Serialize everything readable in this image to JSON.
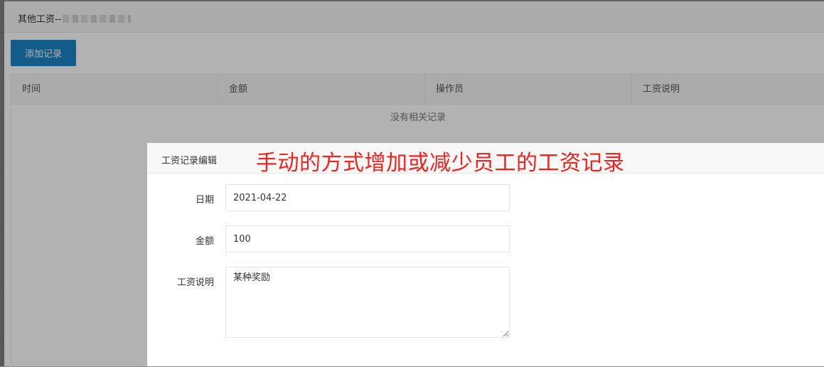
{
  "outer_dialog": {
    "title": "其他工资--",
    "add_button_label": "添加记录",
    "columns": [
      "时间",
      "金额",
      "操作员",
      "工资说明"
    ],
    "empty_text": "没有相关记录"
  },
  "edit_dialog": {
    "title": "工资记录编辑",
    "annotation": "手动的方式增加或减少员工的工资记录",
    "fields": {
      "date": {
        "label": "日期",
        "value": "2021-04-22"
      },
      "amount": {
        "label": "金额",
        "value": "100"
      },
      "description": {
        "label": "工资说明",
        "value": "某种奖励"
      }
    }
  },
  "colors": {
    "primary_button": "#1c84c6",
    "annotation": "#f2231c"
  }
}
